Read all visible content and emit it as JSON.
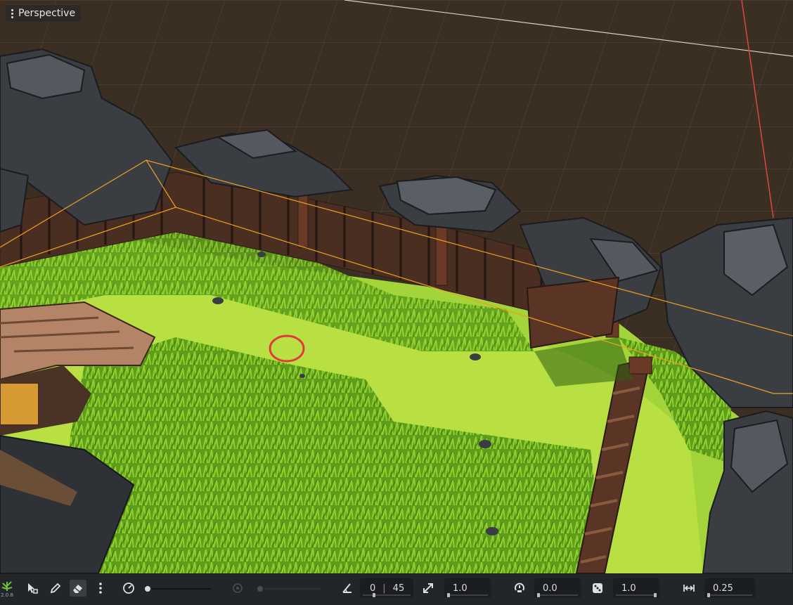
{
  "viewport": {
    "view_label": "Perspective",
    "ground_color": "#3b2e22",
    "grass_color": "#8fd12a"
  },
  "toolbar": {
    "version_label": "2.0.8",
    "tools": [
      {
        "name": "select-tool-icon",
        "active": false
      },
      {
        "name": "paint-tool-icon",
        "active": false
      },
      {
        "name": "erase-tool-icon",
        "active": true
      },
      {
        "name": "more-options-icon",
        "active": false
      }
    ],
    "brush_strength": 0.0,
    "rotation_min": "0",
    "rotation_max": "45",
    "scale": "1.0",
    "random_rotation": "0.0",
    "density": "1.0",
    "spacing": "0.25"
  }
}
